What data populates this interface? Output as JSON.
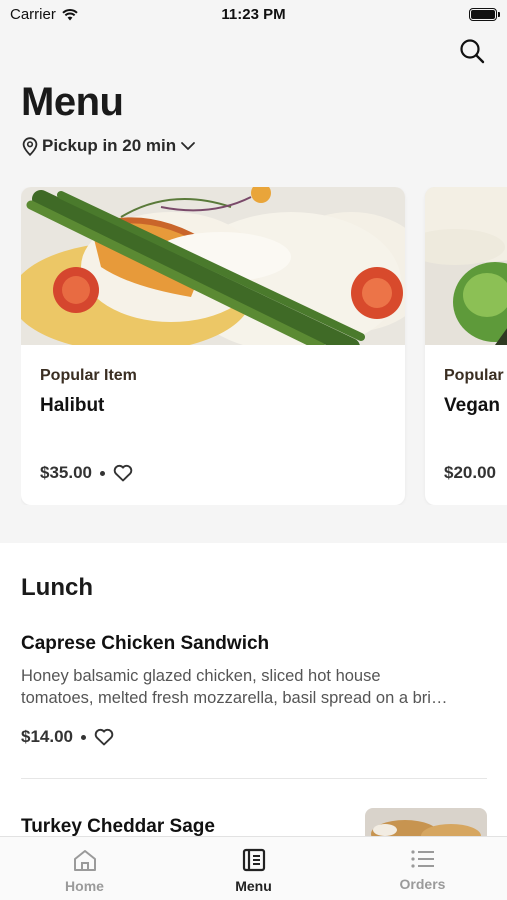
{
  "status_bar": {
    "carrier": "Carrier",
    "time": "11:23 PM"
  },
  "header": {
    "title": "Menu",
    "pickup_label": "Pickup in 20 min"
  },
  "featured": [
    {
      "kicker": "Popular Item",
      "name": "Halibut",
      "price": "$35.00"
    },
    {
      "kicker": "Popular",
      "name": "Vegan",
      "price": "$20.00"
    }
  ],
  "section": {
    "title": "Lunch",
    "items": [
      {
        "name": "Caprese Chicken Sandwich",
        "desc_line1": "Honey balsamic glazed chicken, sliced hot house",
        "desc_line2": "tomatoes, melted fresh mozzarella, basil spread on a bri…",
        "price": "$14.00"
      },
      {
        "name": "Turkey Cheddar Sage"
      }
    ]
  },
  "tabs": [
    {
      "label": "Home",
      "icon": "home-icon",
      "active": false
    },
    {
      "label": "Menu",
      "icon": "menu-book-icon",
      "active": true
    },
    {
      "label": "Orders",
      "icon": "orders-list-icon",
      "active": false
    }
  ],
  "colors": {
    "background": "#f5f5f5",
    "card": "#ffffff",
    "kicker": "#3a2e22",
    "tab_inactive": "#9a9a9a",
    "tab_active": "#222222"
  }
}
